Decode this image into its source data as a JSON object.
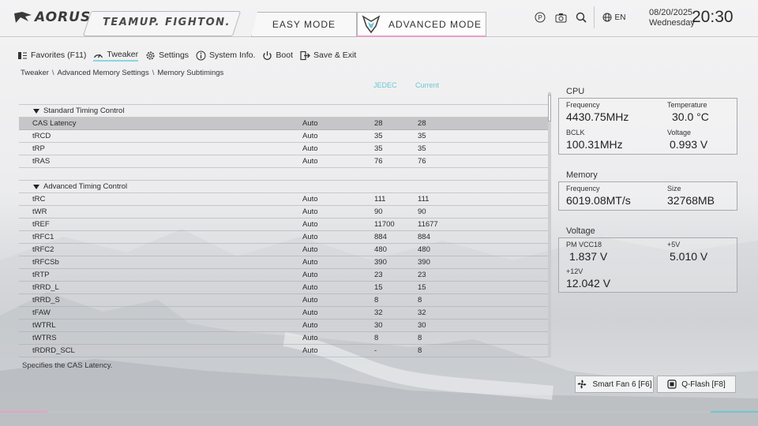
{
  "header": {
    "logo": "AORUS",
    "teamup": "TEAMUP. FIGHTON.",
    "easy_mode": "EASY MODE",
    "advanced_mode": "ADVANCED MODE",
    "language": "EN",
    "date": "08/20/2025",
    "weekday": "Wednesday",
    "time": "20:30"
  },
  "menu": [
    {
      "label": "Favorites (F11)",
      "icon": "favorites-icon"
    },
    {
      "label": "Tweaker",
      "icon": "speedometer-icon",
      "active": true
    },
    {
      "label": "Settings",
      "icon": "gear-icon"
    },
    {
      "label": "System Info.",
      "icon": "info-icon"
    },
    {
      "label": "Boot",
      "icon": "power-icon"
    },
    {
      "label": "Save & Exit",
      "icon": "exit-icon"
    }
  ],
  "breadcrumb": [
    "Tweaker",
    "Advanced Memory Settings",
    "Memory Subtimings"
  ],
  "columns": {
    "jedec": "JEDEC",
    "current": "Current"
  },
  "standard_group": "Standard Timing Control",
  "advanced_group": "Advanced Timing Control",
  "standard_rows": [
    {
      "name": "CAS Latency",
      "mode": "Auto",
      "jedec": "28",
      "current": "28"
    },
    {
      "name": "tRCD",
      "mode": "Auto",
      "jedec": "35",
      "current": "35"
    },
    {
      "name": "tRP",
      "mode": "Auto",
      "jedec": "35",
      "current": "35"
    },
    {
      "name": "tRAS",
      "mode": "Auto",
      "jedec": "76",
      "current": "76"
    }
  ],
  "advanced_rows": [
    {
      "name": "tRC",
      "mode": "Auto",
      "jedec": "111",
      "current": "111"
    },
    {
      "name": "tWR",
      "mode": "Auto",
      "jedec": "90",
      "current": "90"
    },
    {
      "name": "tREF",
      "mode": "Auto",
      "jedec": "11700",
      "current": "11677"
    },
    {
      "name": "tRFC1",
      "mode": "Auto",
      "jedec": "884",
      "current": "884"
    },
    {
      "name": "tRFC2",
      "mode": "Auto",
      "jedec": "480",
      "current": "480"
    },
    {
      "name": "tRFCSb",
      "mode": "Auto",
      "jedec": "390",
      "current": "390"
    },
    {
      "name": "tRTP",
      "mode": "Auto",
      "jedec": "23",
      "current": "23"
    },
    {
      "name": "tRRD_L",
      "mode": "Auto",
      "jedec": "15",
      "current": "15"
    },
    {
      "name": "tRRD_S",
      "mode": "Auto",
      "jedec": "8",
      "current": "8"
    },
    {
      "name": "tFAW",
      "mode": "Auto",
      "jedec": "32",
      "current": "32"
    },
    {
      "name": "tWTRL",
      "mode": "Auto",
      "jedec": "30",
      "current": "30"
    },
    {
      "name": "tWTRS",
      "mode": "Auto",
      "jedec": "8",
      "current": "8"
    },
    {
      "name": "tRDRD_SCL",
      "mode": "Auto",
      "jedec": "-",
      "current": "8"
    }
  ],
  "description": "Specifies the CAS Latency.",
  "cpu": {
    "title": "CPU",
    "frequency_label": "Frequency",
    "frequency": "4430.75MHz",
    "temperature_label": "Temperature",
    "temperature": "30.0 °C",
    "bclk_label": "BCLK",
    "bclk": "100.31MHz",
    "voltage_label": "Voltage",
    "voltage": "0.993 V"
  },
  "memory": {
    "title": "Memory",
    "frequency_label": "Frequency",
    "frequency": "6019.08MT/s",
    "size_label": "Size",
    "size": "32768MB"
  },
  "voltage": {
    "title": "Voltage",
    "pm_label": "PM VCC18",
    "pm": "1.837 V",
    "v5_label": "+5V",
    "v5": "5.010 V",
    "v12_label": "+12V",
    "v12": "12.042 V"
  },
  "footer": {
    "smartfan": "Smart Fan 6 [F6]",
    "qflash": "Q-Flash [F8]"
  },
  "colors": {
    "accent_cyan": "#6cc7d3",
    "accent_pink": "#e8a0c8"
  }
}
